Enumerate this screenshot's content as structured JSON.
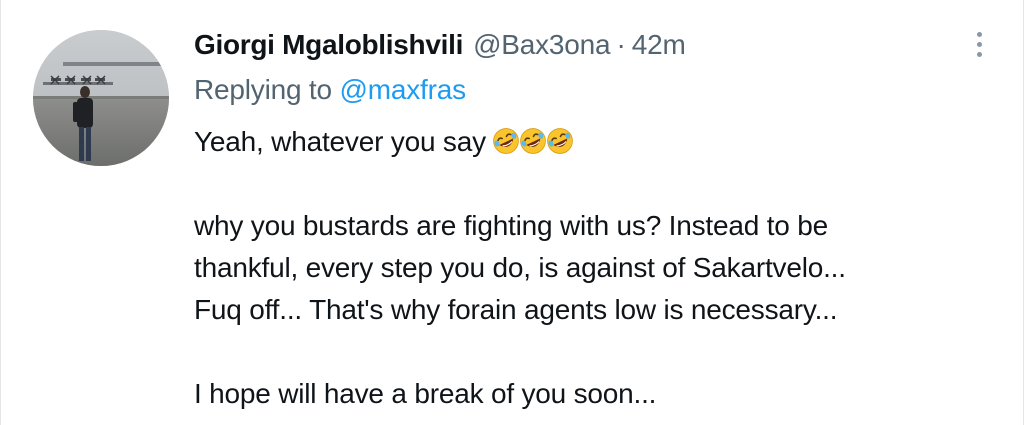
{
  "tweet": {
    "display_name": "Giorgi Mgaloblishvili",
    "handle": "@Bax3ona",
    "separator": "·",
    "time": "42m",
    "replying_prefix": "Replying to",
    "replying_to": "@maxfras",
    "lines": {
      "l1": "Yeah, whatever you say",
      "l2": "why you bustards are fighting with us? Instead to be",
      "l3": "thankful, every step you do, is against of Sakartvelo...",
      "l4": "Fuq off... That's why forain agents low is necessary...",
      "l5": "I hope will have a break of you soon..."
    },
    "emojis": [
      "rolling-on-floor-laughing",
      "rolling-on-floor-laughing",
      "rolling-on-floor-laughing"
    ],
    "more_icon": "more-vertical-icon",
    "colors": {
      "text": "#0f1419",
      "secondary": "#536471",
      "link": "#1d9bf0"
    }
  }
}
